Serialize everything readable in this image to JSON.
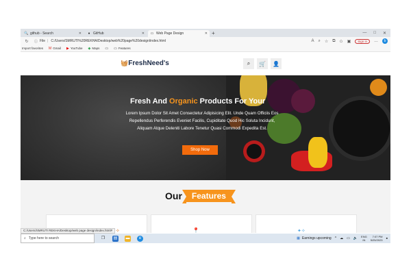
{
  "browser": {
    "tabs": [
      {
        "icon": "search-icon",
        "label": "github - Search",
        "active": false
      },
      {
        "icon": "github-icon",
        "label": "GitHub",
        "active": false
      },
      {
        "icon": "page-icon",
        "label": "Web Page Design",
        "active": true
      }
    ],
    "new_tab": "+",
    "window_controls": [
      "—",
      "□",
      "✕"
    ],
    "address_label": "File",
    "url": "C:/Users/SMRUTI%20REKHA/Desktop/web%20page%20design/index.html",
    "signin_label": "Sign in",
    "favorites": [
      "Import favorites",
      "Gmail",
      "YouTube",
      "Maps",
      "Features"
    ]
  },
  "site": {
    "logo": "FreshNeed's",
    "nav_icons": [
      "search-icon",
      "cart-icon",
      "user-icon"
    ],
    "hero": {
      "title_before": "Fresh And ",
      "title_highlight": "Organic",
      "title_after": " Products For Your",
      "body": "Lorem Ipsum Dolor Sit Amet Consectetur Adipisicing Elit. Unde Quam Officiis Eos Repellendus Perferendis Eveniet Facilis, Cupiditate Quod Hic Soluta Incidunt, Aliquam Atque Deleniti Labore Tenetur Quasi Commodi Expedita Est.",
      "button": "Shop Now"
    },
    "features": {
      "heading_our": "Our",
      "heading_tag": "Features"
    }
  },
  "status_url": "C:/Users/SMRUTI REKHA/Desktop/web page design/index.html#",
  "taskbar": {
    "search_placeholder": "Type here to search",
    "weather": "Earnings upcoming",
    "lang_top": "ENG",
    "lang_bottom": "IN",
    "time": "7:07 PM",
    "date": "5/25/2023"
  },
  "colors": {
    "accent": "#f7941d",
    "button": "#f26b0c",
    "logo": "#1c2b47"
  }
}
